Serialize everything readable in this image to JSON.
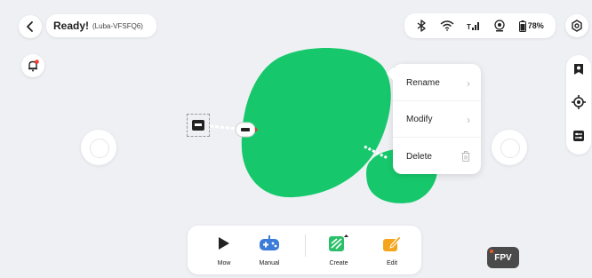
{
  "header": {
    "status": "Ready!",
    "device": "(Luba-VFSFQ6)",
    "battery": "78%",
    "icons": [
      "back-icon",
      "bluetooth-icon",
      "wifi-icon",
      "cellular-icon",
      "gps-icon",
      "battery-icon",
      "settings-icon"
    ]
  },
  "colors": {
    "lawn": "#16c86b",
    "background": "#eef0f4",
    "accent_orange": "#f5a51b",
    "accent_blue": "#3d7bd9",
    "accent_green": "#2bbf6a",
    "alert_red": "#ff3b30"
  },
  "context_menu": {
    "rename": "Rename",
    "modify": "Modify",
    "delete": "Delete"
  },
  "toolbar": {
    "mow": "Mow",
    "manual": "Manual",
    "create": "Create",
    "edit": "Edit"
  },
  "fpv": "FPV",
  "side_icons": [
    "bookmark-icon",
    "locate-icon",
    "layers-icon"
  ]
}
